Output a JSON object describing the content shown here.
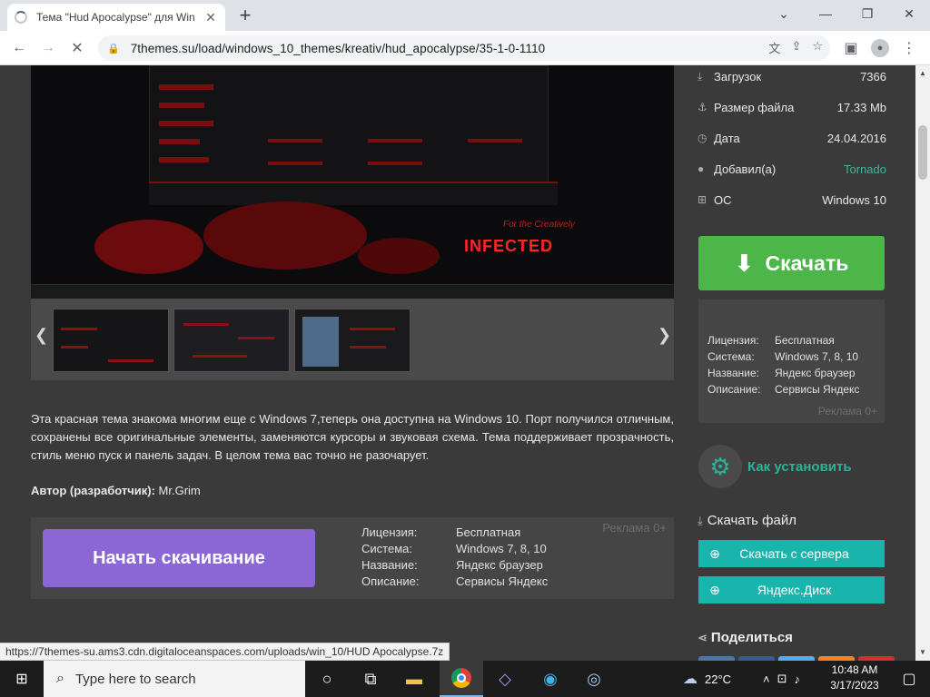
{
  "browser": {
    "tab_title": "Тема \"Hud Apocalypse\" для Win",
    "tab_close": "✕",
    "new_tab": "+",
    "url": "7themes.su/load/windows_10_themes/kreativ/hud_apocalypse/35-1-0-1110",
    "status_url": "https://7themes-su.ams3.cdn.digitaloceanspaces.com/uploads/win_10/HUD Apocalypse.7z"
  },
  "screenshot": {
    "infected": "INFECTED",
    "creatively": "For the Creatively"
  },
  "description": "Эта красная тема знакома многим еще с Windows 7,теперь она доступна на Windows 10. Порт получился отличным, сохранены все оригинальные элементы, заменяются курсоры и звуковая схема. Тема поддерживает прозрачность, стиль меню пуск и панель задач. В целом тема вас точно не разочарует.",
  "author": {
    "label": "Автор (разработчик):",
    "value": "Mr.Grim"
  },
  "ad_main": {
    "button": "Начать скачивание",
    "mark": "Реклама 0+",
    "rows": [
      {
        "k": "Лицензия:",
        "v": "Бесплатная"
      },
      {
        "k": "Система:",
        "v": "Windows 7, 8, 10"
      },
      {
        "k": "Название:",
        "v": "Яндекс браузер"
      },
      {
        "k": "Описание:",
        "v": "Сервисы Яндекс"
      }
    ]
  },
  "info": [
    {
      "icon": "⤓",
      "k": "Загрузок",
      "v": "7366"
    },
    {
      "icon": "⚓",
      "k": "Размер файла",
      "v": "17.33 Mb"
    },
    {
      "icon": "◷",
      "k": "Дата",
      "v": "24.04.2016"
    },
    {
      "icon": "●",
      "k": "Добавил(а)",
      "v": "Tornado"
    },
    {
      "icon": "⊞",
      "k": "ОС",
      "v": "Windows 10"
    }
  ],
  "download_big": "Скачать",
  "ad_side": {
    "mark": "Реклама 0+",
    "rows": [
      {
        "k": "Лицензия:",
        "v": "Бесплатная"
      },
      {
        "k": "Система:",
        "v": "Windows 7, 8, 10"
      },
      {
        "k": "Название:",
        "v": "Яндекс браузер"
      },
      {
        "k": "Описание:",
        "v": "Сервисы Яндекс"
      }
    ]
  },
  "how_to": "Как установить",
  "download_file": {
    "title": "Скачать файл",
    "server": "Скачать с сервера",
    "yadisk": "Яндекс.Диск"
  },
  "share": "Поделиться",
  "taskbar": {
    "search_placeholder": "Type here to search",
    "weather": "22°C",
    "time": "10:48 AM",
    "date": "3/17/2023"
  },
  "colors": {
    "download_green": "#4cb748",
    "teal": "#19b5ad",
    "ad_purple": "#8b67d6",
    "link_teal": "#3fb59a"
  }
}
